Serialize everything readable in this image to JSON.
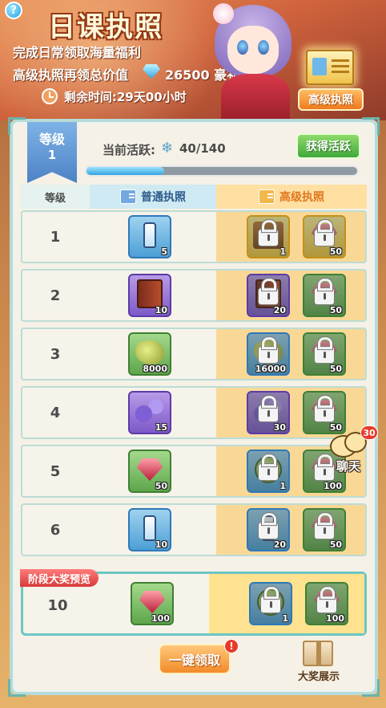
{
  "banner": {
    "title": "日课执照",
    "line1": "完成日常领取海量福利",
    "line2": "高级执照再领总价值",
    "gem_value": "26500 豪礼",
    "time_left": "剩余时间:29天00小时",
    "premium_button_label": "高级执照",
    "help_label": "?"
  },
  "level": {
    "label": "等级",
    "value": "1"
  },
  "activity": {
    "label": "当前活跃:",
    "icon_glyph": "❄",
    "value": "40/140",
    "current": 40,
    "max": 140,
    "button_label": "获得活跃"
  },
  "table_header": {
    "level": "等级",
    "normal": "普通执照",
    "premium": "高级执照"
  },
  "rows": [
    {
      "level": "1",
      "normal": {
        "art": "bottle",
        "frame": "blue",
        "count": "5"
      },
      "p1": {
        "art": "chest",
        "frame": "gold",
        "count": "1"
      },
      "p2": {
        "art": "gem",
        "frame": "gold",
        "count": "50"
      }
    },
    {
      "level": "2",
      "normal": {
        "art": "book",
        "frame": "purple",
        "count": "10"
      },
      "p1": {
        "art": "book",
        "frame": "purple",
        "count": "20"
      },
      "p2": {
        "art": "gem",
        "frame": "green",
        "count": "50"
      }
    },
    {
      "level": "3",
      "normal": {
        "art": "ore",
        "frame": "green",
        "count": "8000"
      },
      "p1": {
        "art": "ore",
        "frame": "blue",
        "count": "16000"
      },
      "p2": {
        "art": "gem",
        "frame": "green",
        "count": "50"
      }
    },
    {
      "level": "4",
      "normal": {
        "art": "stars",
        "frame": "purple",
        "count": "15"
      },
      "p1": {
        "art": "stars",
        "frame": "purple",
        "count": "30"
      },
      "p2": {
        "art": "gem",
        "frame": "green",
        "count": "50"
      }
    },
    {
      "level": "5",
      "normal": {
        "art": "gem",
        "frame": "green",
        "count": "50"
      },
      "p1": {
        "art": "coin",
        "frame": "blue",
        "count": "1"
      },
      "p2": {
        "art": "gem",
        "frame": "green",
        "count": "100"
      }
    },
    {
      "level": "6",
      "normal": {
        "art": "bottle",
        "frame": "blue",
        "count": "10"
      },
      "p1": {
        "art": "bottle",
        "frame": "blue",
        "count": "20"
      },
      "p2": {
        "art": "gem",
        "frame": "green",
        "count": "50"
      }
    }
  ],
  "milestone": {
    "tag": "阶段大奖预览",
    "level": "10",
    "normal": {
      "art": "gem",
      "frame": "green",
      "count": "100"
    },
    "p1": {
      "art": "coin",
      "frame": "blue",
      "count": "1"
    },
    "p2": {
      "art": "gem",
      "frame": "green",
      "count": "100"
    }
  },
  "footer": {
    "claim_all_label": "一键领取",
    "claim_alert": "!",
    "grand_prize_label": "大奖展示"
  },
  "chat": {
    "badge": "30",
    "label": "聊天"
  },
  "colors": {
    "normal_column": "#cfeaf2",
    "premium_column": "#f9d896",
    "progress_fill": "#32a6e0",
    "accent_orange": "#f07a1e",
    "accent_green": "#3fa83a"
  }
}
